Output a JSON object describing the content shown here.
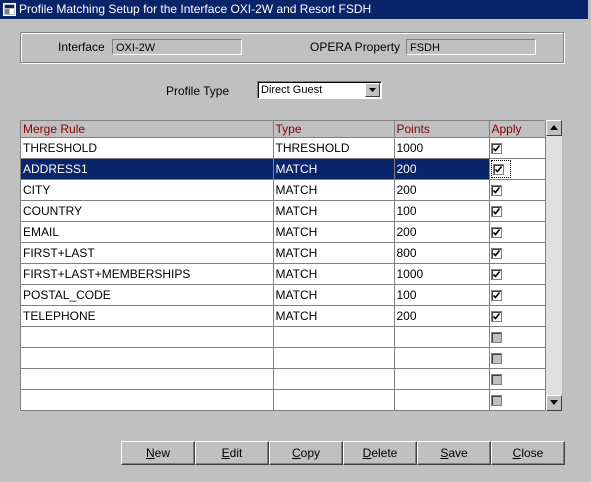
{
  "window": {
    "title": "Profile Matching Setup for the Interface OXI-2W and Resort FSDH"
  },
  "header": {
    "interface_label": "Interface",
    "interface_value": "OXI-2W",
    "property_label": "OPERA Property",
    "property_value": "FSDH"
  },
  "profile_type": {
    "label": "Profile Type",
    "selected": "Direct Guest"
  },
  "grid": {
    "columns": [
      "Merge Rule",
      "Type",
      "Points",
      "Apply"
    ],
    "rows": [
      {
        "rule": "THRESHOLD",
        "type": "THRESHOLD",
        "points": "1000",
        "apply": true
      },
      {
        "rule": "ADDRESS1",
        "type": "MATCH",
        "points": "200",
        "apply": true,
        "selected": true
      },
      {
        "rule": "CITY",
        "type": "MATCH",
        "points": "200",
        "apply": true
      },
      {
        "rule": "COUNTRY",
        "type": "MATCH",
        "points": "100",
        "apply": true
      },
      {
        "rule": "EMAIL",
        "type": "MATCH",
        "points": "200",
        "apply": true
      },
      {
        "rule": "FIRST+LAST",
        "type": "MATCH",
        "points": "800",
        "apply": true
      },
      {
        "rule": "FIRST+LAST+MEMBERSHIPS",
        "type": "MATCH",
        "points": "1000",
        "apply": true
      },
      {
        "rule": "POSTAL_CODE",
        "type": "MATCH",
        "points": "100",
        "apply": true
      },
      {
        "rule": "TELEPHONE",
        "type": "MATCH",
        "points": "200",
        "apply": true
      }
    ],
    "empty_rows": 4
  },
  "buttons": [
    {
      "label": "New",
      "mnemonic": "N",
      "rest": "ew",
      "name": "new-button"
    },
    {
      "label": "Edit",
      "mnemonic": "E",
      "rest": "dit",
      "name": "edit-button"
    },
    {
      "label": "Copy",
      "mnemonic": "C",
      "rest": "opy",
      "name": "copy-button"
    },
    {
      "label": "Delete",
      "mnemonic": "D",
      "rest": "elete",
      "name": "delete-button"
    },
    {
      "label": "Save",
      "mnemonic": "S",
      "rest": "ave",
      "name": "save-button"
    },
    {
      "label": "Close",
      "mnemonic": "C",
      "rest": "lose",
      "name": "close-button"
    }
  ],
  "colors": {
    "titlebar": "#0a246a",
    "selection": "#0a246a",
    "column_header_text": "#8b0000",
    "background": "#c0c0c0"
  },
  "icons": [
    "window-app-icon",
    "dropdown-arrow-icon",
    "scroll-up-icon",
    "scroll-down-icon",
    "checkmark-icon"
  ]
}
